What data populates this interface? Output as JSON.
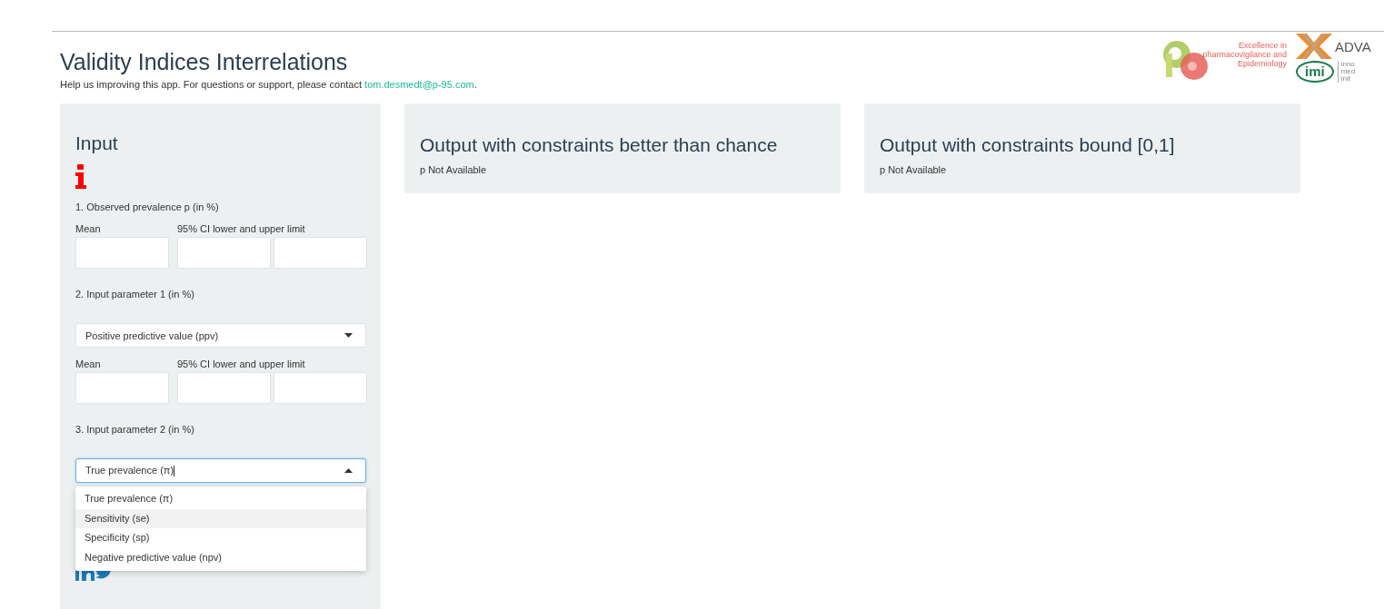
{
  "header": {
    "title": "Validity Indices Interrelations",
    "help_text": "Help us improving this app. For questions or support, please contact ",
    "contact_link": "tom.desmedt@p-95.com",
    "help_end": "."
  },
  "logos": {
    "p95_tagline": "Excellence in pharmacovigilance and Epidemiology",
    "advance_text": "ADVA",
    "imi_text": "imi",
    "imi_side_text": [
      "inno",
      "med",
      "init"
    ]
  },
  "input_panel": {
    "title": "Input",
    "prevalence": {
      "label": "1. Observed prevalence p (in %)",
      "mean_label": "Mean",
      "ci_label": "95% CI lower and upper limit"
    },
    "parameter_1": {
      "label": "2. Input parameter 1 (in %)",
      "select": {
        "value": "Positive predictive value (ppv)",
        "expanded": false
      },
      "mean_label": "Mean",
      "ci_label": "95% CI lower and upper limit"
    },
    "parameter_2": {
      "label": "3. Input parameter 2 (in %)",
      "select": {
        "value": "True prevalence (π)",
        "expanded": true,
        "options": [
          {
            "label": "True prevalence (π)",
            "highlighted": false
          },
          {
            "label": "Sensitivity (se)",
            "highlighted": true
          },
          {
            "label": "Specificity (sp)",
            "highlighted": false
          },
          {
            "label": "Negative predictive value (npv)",
            "highlighted": false
          }
        ]
      }
    }
  },
  "output_panels": [
    {
      "title": "Output with constraints better than chance",
      "status": "p Not Available"
    },
    {
      "title": "Output with constraints bound [0,1]",
      "status": "p Not Available"
    }
  ]
}
